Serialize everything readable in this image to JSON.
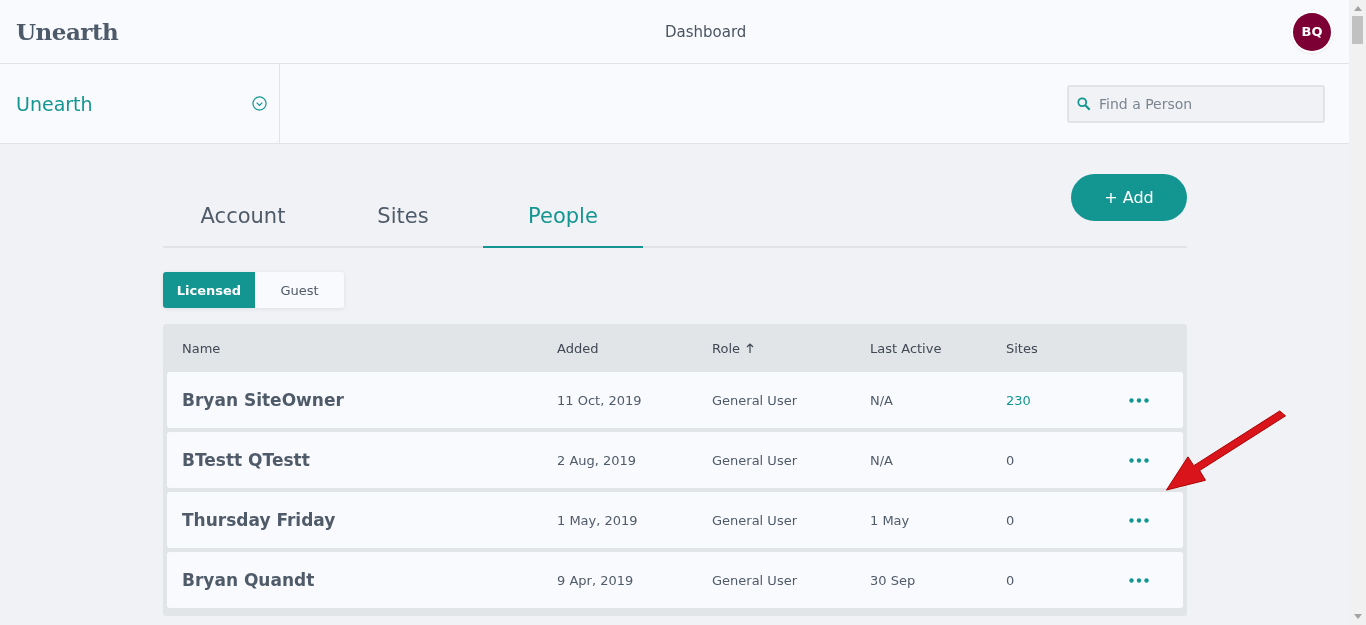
{
  "header": {
    "logo": "Unearth",
    "title": "Dashboard",
    "avatar": "BQ"
  },
  "org_selector": {
    "label": "Unearth"
  },
  "search": {
    "placeholder": "Find a Person"
  },
  "tabs": [
    {
      "label": "Account",
      "selected": false
    },
    {
      "label": "Sites",
      "selected": false
    },
    {
      "label": "People",
      "selected": true
    }
  ],
  "add_button": {
    "label": "+ Add"
  },
  "filter": [
    {
      "label": "Licensed",
      "selected": true
    },
    {
      "label": "Guest",
      "selected": false
    }
  ],
  "table": {
    "columns": [
      {
        "label": "Name",
        "sorted": false
      },
      {
        "label": "Added",
        "sorted": false
      },
      {
        "label": "Role",
        "sorted": true
      },
      {
        "label": "Last Active",
        "sorted": false
      },
      {
        "label": "Sites",
        "sorted": false
      }
    ],
    "rows": [
      {
        "name": "Bryan SiteOwner",
        "added": "11 Oct, 2019",
        "role": "General User",
        "last_active": "N/A",
        "sites": "230",
        "sites_linked": true,
        "annotated": false
      },
      {
        "name": "BTestt QTestt",
        "added": "2 Aug, 2019",
        "role": "General User",
        "last_active": "N/A",
        "sites": "0",
        "sites_linked": false,
        "annotated": true
      },
      {
        "name": "Thursday Friday",
        "added": "1 May, 2019",
        "role": "General User",
        "last_active": "1 May",
        "sites": "0",
        "sites_linked": false,
        "annotated": false
      },
      {
        "name": "Bryan Quandt",
        "added": "9 Apr, 2019",
        "role": "General User",
        "last_active": "30 Sep",
        "sites": "0",
        "sites_linked": false,
        "annotated": false
      }
    ]
  }
}
